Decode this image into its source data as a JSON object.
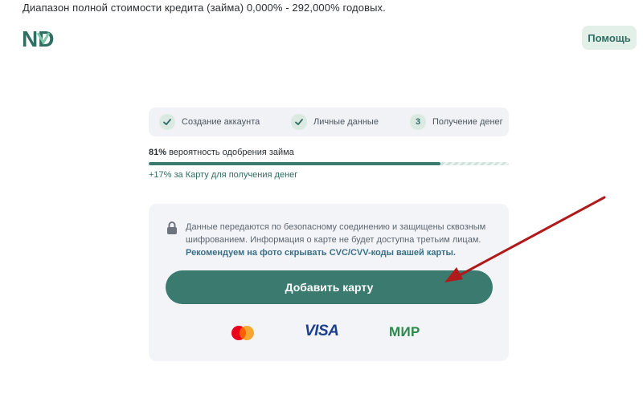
{
  "header": {
    "disclaimer": "Диапазон полной стоимости кредита (займа) 0,000% - 292,000% годовых.",
    "logo_text": "ND",
    "help_label": "Помощь"
  },
  "steps": [
    {
      "label": "Создание аккаунта",
      "marker": "check",
      "state": "done"
    },
    {
      "label": "Личные данные",
      "marker": "check",
      "state": "done"
    },
    {
      "label": "Получение денег",
      "marker": "3",
      "state": "current"
    }
  ],
  "approval": {
    "percent": "81%",
    "text": " вероятность одобрения займа",
    "progress_value": 0.81,
    "bonus_percent": "+17%",
    "bonus_text": " за Карту для получения денег"
  },
  "card": {
    "info_text": "Данные передаются по безопасному соединению и защищены сквозным шифрованием. Информация о карте не будет доступна третьим лицам.",
    "info_strong": "Рекомендуем на фото скрывать CVC/CVV-коды вашей карты.",
    "add_button_label": "Добавить карту",
    "payment_systems": [
      "mastercard-icon",
      "VISA",
      "МИР"
    ]
  },
  "colors": {
    "accent": "#3b7a6f",
    "accent_light": "#e3efe9",
    "arrow": "#b01a1a"
  }
}
